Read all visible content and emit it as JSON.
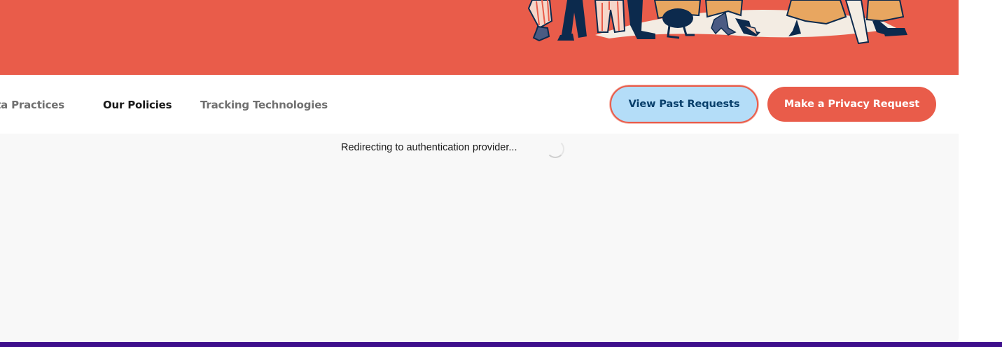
{
  "nav": {
    "items": [
      {
        "label": "Data Practices",
        "active": false
      },
      {
        "label": "Our Policies",
        "active": true
      },
      {
        "label": "Tracking Technologies",
        "active": false
      }
    ]
  },
  "actions": {
    "view_past_requests": "View Past Requests",
    "make_privacy_request": "Make a Privacy Request"
  },
  "status": {
    "message": "Redirecting to authentication provider...",
    "icon": "loading-spinner-icon"
  },
  "colors": {
    "brand_coral": "#e95c4a",
    "secondary_button_bg": "#b4ddf8",
    "secondary_button_text": "#083f6b",
    "footer_purple": "#3e0f8c"
  }
}
